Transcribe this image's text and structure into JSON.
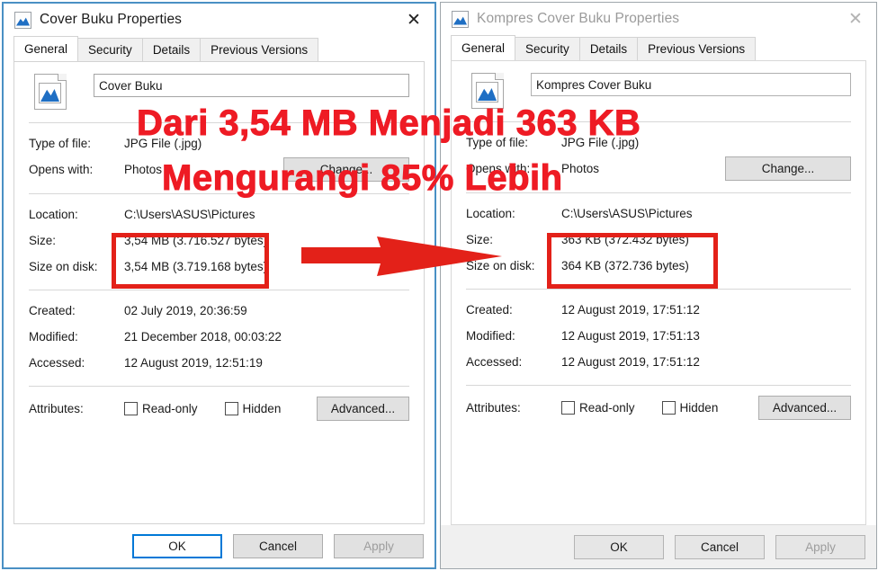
{
  "windows": [
    {
      "id": "left",
      "state": "active",
      "title": "Cover Buku Properties",
      "title_icon": "image-file-icon",
      "close_label": "✕",
      "tabs": [
        {
          "label": "General",
          "selected": true
        },
        {
          "label": "Security",
          "selected": false
        },
        {
          "label": "Details",
          "selected": false
        },
        {
          "label": "Previous Versions",
          "selected": false
        }
      ],
      "file_name": "Cover Buku",
      "fields": {
        "type_label": "Type of file:",
        "type_value": "JPG File (.jpg)",
        "opens_label": "Opens with:",
        "opens_value": "Photos",
        "change_button": "Change...",
        "location_label": "Location:",
        "location_value": "C:\\Users\\ASUS\\Pictures",
        "size_label": "Size:",
        "size_value": "3,54 MB (3.716.527 bytes)",
        "size_on_disk_label": "Size on disk:",
        "size_on_disk_value": "3,54 MB (3.719.168 bytes)",
        "created_label": "Created:",
        "created_value": "02 July 2019, 20:36:59",
        "modified_label": "Modified:",
        "modified_value": "21 December 2018, 00:03:22",
        "accessed_label": "Accessed:",
        "accessed_value": "12 August 2019, 12:51:19",
        "attributes_label": "Attributes:",
        "readonly_label": "Read-only",
        "hidden_label": "Hidden",
        "advanced_button": "Advanced..."
      },
      "footer": {
        "ok": "OK",
        "cancel": "Cancel",
        "apply": "Apply"
      }
    },
    {
      "id": "right",
      "state": "inactive",
      "title": "Kompres Cover Buku Properties",
      "title_icon": "image-file-icon",
      "close_label": "✕",
      "tabs": [
        {
          "label": "General",
          "selected": true
        },
        {
          "label": "Security",
          "selected": false
        },
        {
          "label": "Details",
          "selected": false
        },
        {
          "label": "Previous Versions",
          "selected": false
        }
      ],
      "file_name": "Kompres Cover Buku",
      "fields": {
        "type_label": "Type of file:",
        "type_value": "JPG File (.jpg)",
        "opens_label": "Opens with:",
        "opens_value": "Photos",
        "change_button": "Change...",
        "location_label": "Location:",
        "location_value": "C:\\Users\\ASUS\\Pictures",
        "size_label": "Size:",
        "size_value": "363 KB (372.432 bytes)",
        "size_on_disk_label": "Size on disk:",
        "size_on_disk_value": "364 KB (372.736 bytes)",
        "created_label": "Created:",
        "created_value": "12 August 2019, 17:51:12",
        "modified_label": "Modified:",
        "modified_value": "12 August 2019, 17:51:13",
        "accessed_label": "Accessed:",
        "accessed_value": "12 August 2019, 17:51:12",
        "attributes_label": "Attributes:",
        "readonly_label": "Read-only",
        "hidden_label": "Hidden",
        "advanced_button": "Advanced..."
      },
      "footer": {
        "ok": "OK",
        "cancel": "Cancel",
        "apply": "Apply"
      }
    }
  ],
  "annotations": {
    "line1": "Dari 3,54 MB Menjadi 363 KB",
    "line2": "Mengurangi 85% Lebih",
    "arrow_name": "red-arrow-pointing-right",
    "color": "#ee1b24",
    "box_color": "#e32119"
  },
  "colors": {
    "accent": "#0078d7",
    "active_window_border": "#4a90c4",
    "annotation_red": "#ee1b24",
    "icon_blue": "#1f6fc4"
  }
}
